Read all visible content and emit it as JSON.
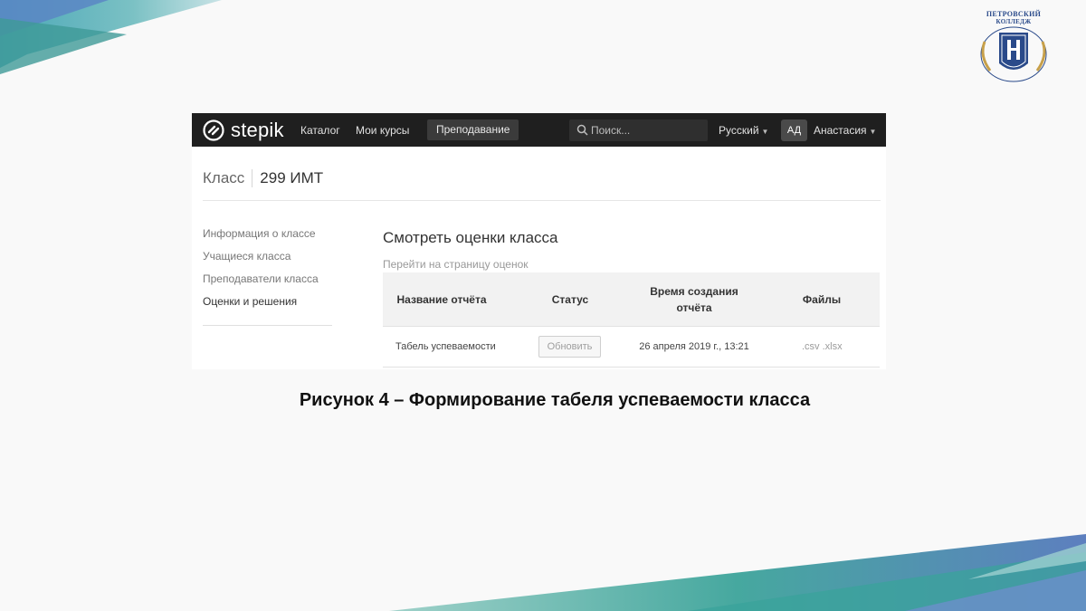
{
  "logo": {
    "title_line1": "ПЕТРОВСКИЙ",
    "title_line2": "КОЛЛЕДЖ",
    "icon": "college-emblem-icon"
  },
  "navbar": {
    "brand": "stepik",
    "brand_icon": "stepik-logo-icon",
    "links": [
      "Каталог",
      "Мои курсы",
      "Преподавание"
    ],
    "active_link": "Преподавание",
    "search_placeholder": "Поиск...",
    "language": "Русский",
    "avatar_initials": "АД",
    "user_name": "Анастасия"
  },
  "breadcrumb": {
    "label": "Класс",
    "value": "299 ИМТ"
  },
  "sidebar": {
    "items": [
      "Информация о классе",
      "Учащиеся класса",
      "Преподаватели класса",
      "Оценки и решения"
    ],
    "current": "Оценки и решения"
  },
  "main": {
    "title": "Смотреть оценки класса",
    "link": "Перейти на страницу оценок"
  },
  "table": {
    "headers": [
      "Название отчёта",
      "Статус",
      "Время создания",
      "отчёта",
      "Файлы"
    ],
    "rows": [
      {
        "name": "Табель успеваемости",
        "status_button": "Обновить",
        "created": "26 апреля 2019 г., 13:21",
        "file_csv": ".csv",
        "file_xlsx": ".xlsx"
      }
    ]
  },
  "caption": "Рисунок 4 – Формирование табеля успеваемости класса",
  "colors": {
    "navbar_bg": "#1f1f1f",
    "teal": "#3aa3a0",
    "blue": "#4d79b8"
  }
}
